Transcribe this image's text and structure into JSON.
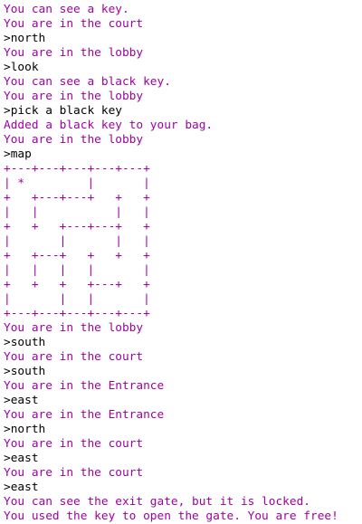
{
  "colors": {
    "output": "#a000a0",
    "command": "#000000",
    "background": "#ffffff"
  },
  "lines": [
    {
      "type": "out",
      "text": "You can see a key."
    },
    {
      "type": "out",
      "text": "You are in the court"
    },
    {
      "type": "cmd",
      "text": ">north"
    },
    {
      "type": "out",
      "text": "You are in the lobby"
    },
    {
      "type": "cmd",
      "text": ">look"
    },
    {
      "type": "out",
      "text": "You can see a black key."
    },
    {
      "type": "out",
      "text": "You are in the lobby"
    },
    {
      "type": "cmd",
      "text": ">pick a black key"
    },
    {
      "type": "out",
      "text": "Added a black key to your bag."
    },
    {
      "type": "out",
      "text": "You are in the lobby"
    },
    {
      "type": "cmd",
      "text": ">map"
    },
    {
      "type": "map",
      "text": "+---+---+---+---+---+"
    },
    {
      "type": "map",
      "text": "| *         |       |"
    },
    {
      "type": "map",
      "text": "+   +---+---+   +   +"
    },
    {
      "type": "map",
      "text": "|   |           |   |"
    },
    {
      "type": "map",
      "text": "+   +   +---+---+   +"
    },
    {
      "type": "map",
      "text": "|       |       |   |"
    },
    {
      "type": "map",
      "text": "+   +---+   +   +   +"
    },
    {
      "type": "map",
      "text": "|   |   |   |       |"
    },
    {
      "type": "map",
      "text": "+   +   +   +---+   +"
    },
    {
      "type": "map",
      "text": "|       |   |       |"
    },
    {
      "type": "map",
      "text": "+---+---+---+---+---+"
    },
    {
      "type": "out",
      "text": "You are in the lobby"
    },
    {
      "type": "cmd",
      "text": ">south"
    },
    {
      "type": "out",
      "text": "You are in the court"
    },
    {
      "type": "cmd",
      "text": ">south"
    },
    {
      "type": "out",
      "text": "You are in the Entrance"
    },
    {
      "type": "cmd",
      "text": ">east"
    },
    {
      "type": "out",
      "text": "You are in the Entrance"
    },
    {
      "type": "cmd",
      "text": ">north"
    },
    {
      "type": "out",
      "text": "You are in the court"
    },
    {
      "type": "cmd",
      "text": ">east"
    },
    {
      "type": "out",
      "text": "You are in the court"
    },
    {
      "type": "cmd",
      "text": ">east"
    },
    {
      "type": "out",
      "text": "You can see the exit gate, but it is locked."
    },
    {
      "type": "out",
      "text": "You used the key to open the gate. You are free!"
    }
  ]
}
